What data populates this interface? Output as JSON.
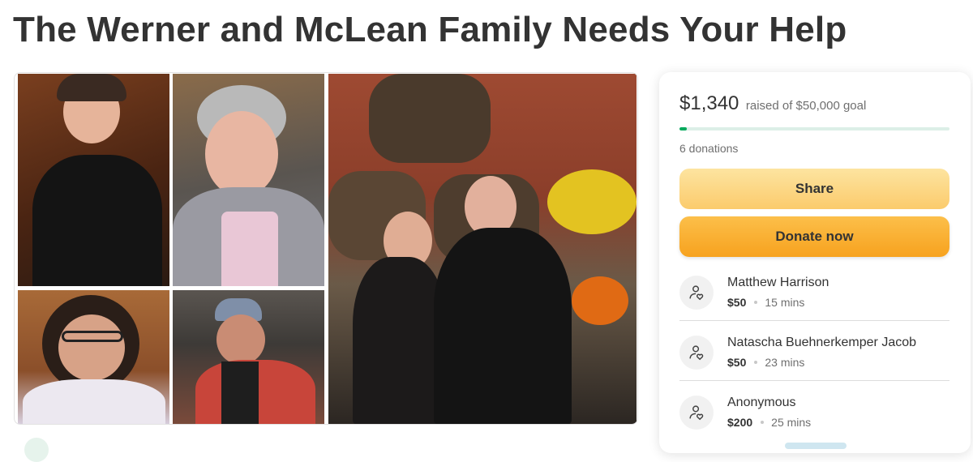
{
  "page": {
    "title": "The Werner and McLean Family Needs Your Help"
  },
  "fundraiser": {
    "raised_amount": "$1,340",
    "raised_text": "raised of $50,000 goal",
    "progress_fraction": 0.0268,
    "donation_count": "6 donations",
    "share_label": "Share",
    "donate_label": "Donate now"
  },
  "donations": [
    {
      "name": "Matthew Harrison",
      "amount": "$50",
      "time": "15 mins"
    },
    {
      "name": "Natascha Buehnerkemper Jacob",
      "amount": "$50",
      "time": "23 mins"
    },
    {
      "name": "Anonymous",
      "amount": "$200",
      "time": "25 mins"
    }
  ],
  "icons": {
    "donor_icon": "donor-heart-icon"
  },
  "colors": {
    "progress": "#02a95c",
    "share_button": "#fbcb6c",
    "donate_button": "#f7a21e"
  }
}
